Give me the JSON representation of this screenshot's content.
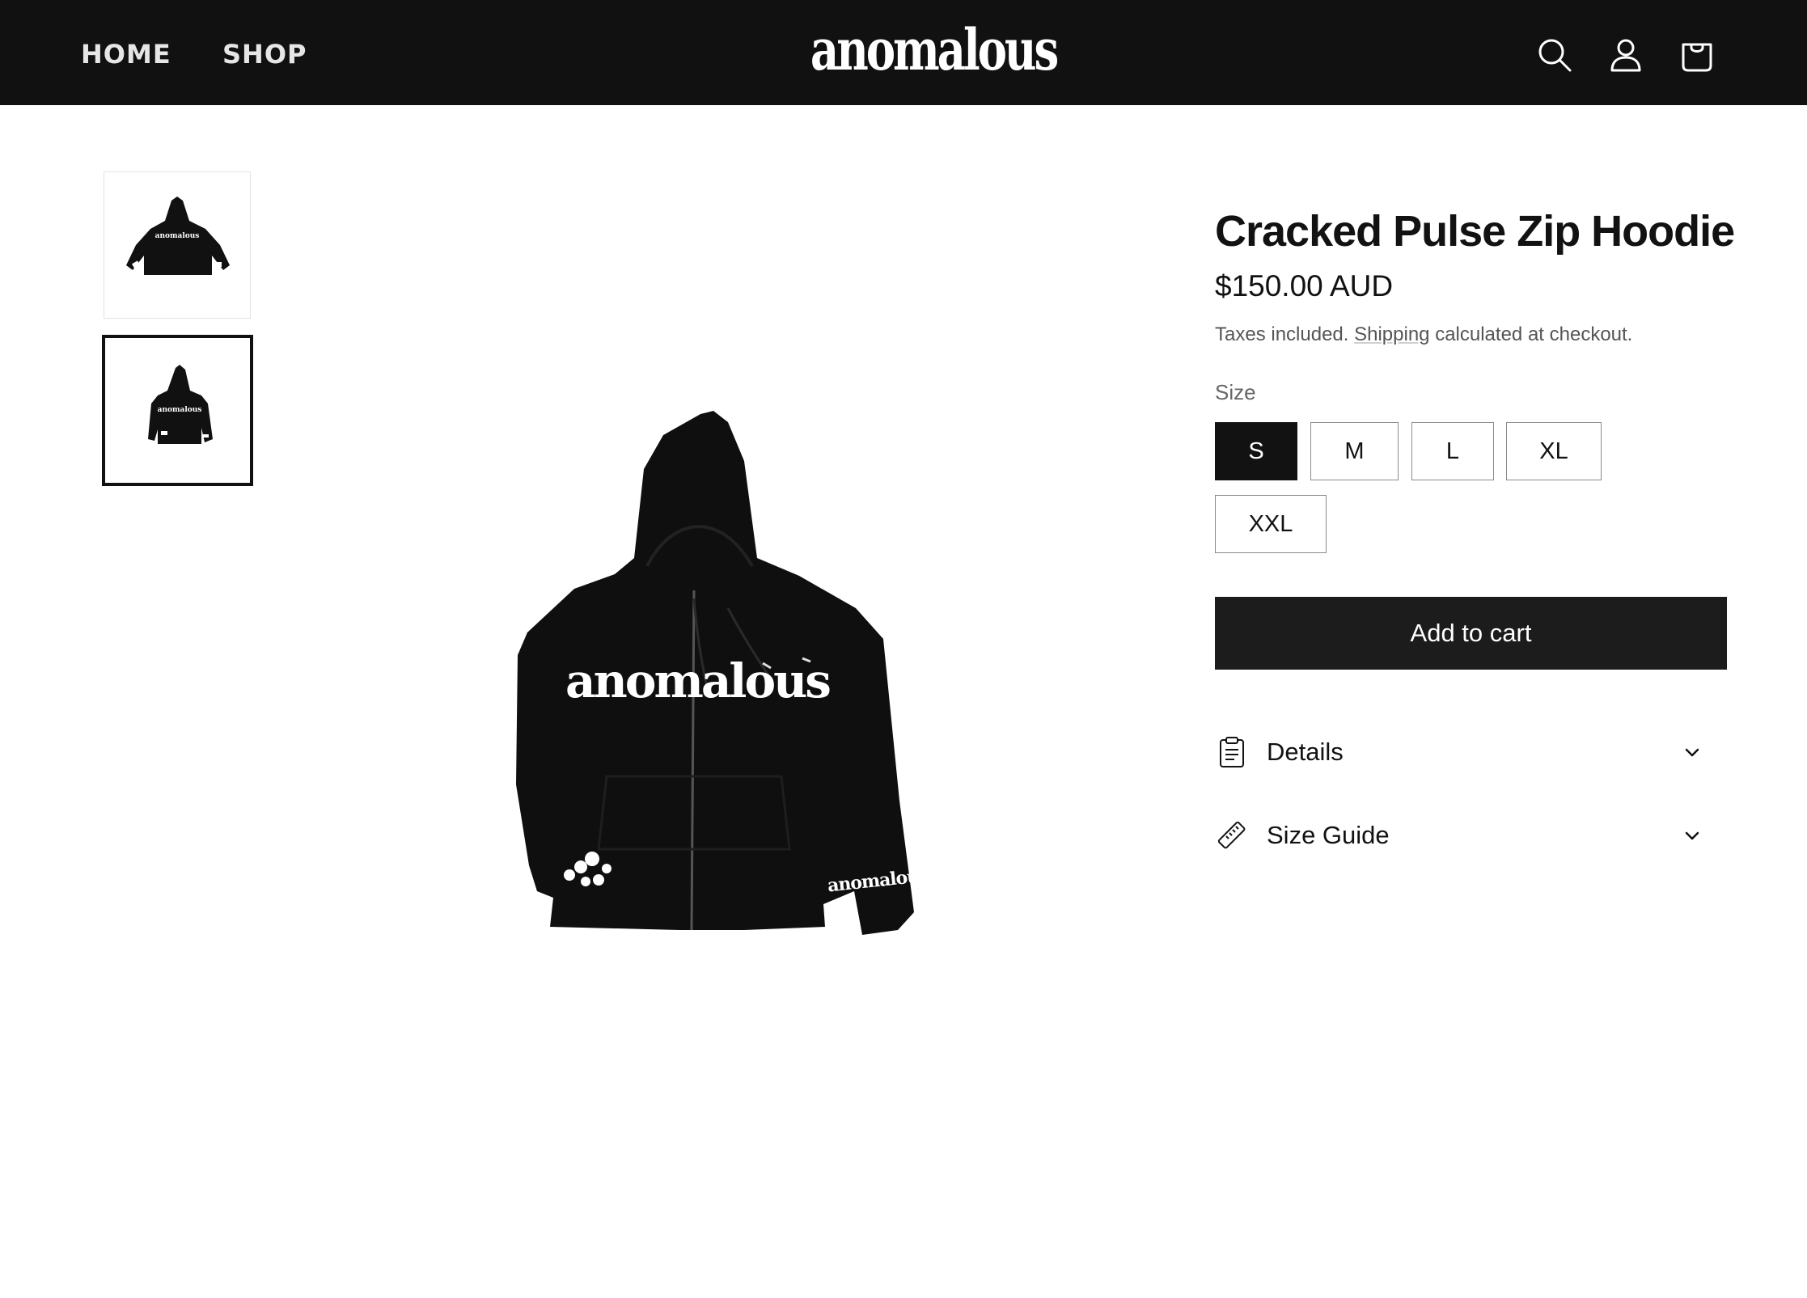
{
  "header": {
    "nav": [
      {
        "label": "HOME"
      },
      {
        "label": "SHOP"
      }
    ],
    "logo_text": "anomalous",
    "icons": [
      "search-icon",
      "account-icon",
      "cart-icon"
    ]
  },
  "gallery": {
    "thumbnails": [
      {
        "label": "anomalous",
        "selected": false
      },
      {
        "label": "anomalous",
        "selected": true
      }
    ],
    "main_image": {
      "chest_print": "anomalous",
      "sleeve_print": "anomalous"
    }
  },
  "product": {
    "title": "Cracked Pulse Zip Hoodie",
    "price": "$150.00 AUD",
    "tax_note_before": "Taxes included. ",
    "tax_note_link": "Shipping",
    "tax_note_after": " calculated at checkout.",
    "size_label": "Size",
    "sizes": [
      {
        "label": "S",
        "selected": true
      },
      {
        "label": "M",
        "selected": false
      },
      {
        "label": "L",
        "selected": false
      },
      {
        "label": "XL",
        "selected": false
      },
      {
        "label": "XXL",
        "selected": false
      }
    ],
    "add_to_cart_label": "Add to cart",
    "accordions": [
      {
        "label": "Details",
        "icon": "clipboard-icon"
      },
      {
        "label": "Size Guide",
        "icon": "ruler-icon"
      }
    ]
  },
  "colors": {
    "header_bg": "#111111",
    "button_dark": "#1c1c1c",
    "text": "#121212"
  }
}
